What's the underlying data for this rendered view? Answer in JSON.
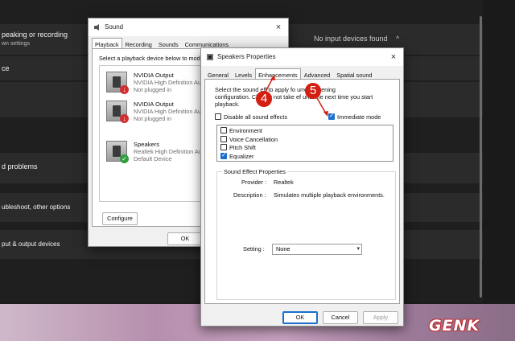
{
  "settings": {
    "row1_title": "peaking or recording",
    "row1_sub": "wn settings",
    "row1_status": "No input devices found",
    "row1_chevron": "^",
    "row2_title": "ce",
    "row3_title": "d problems",
    "row4_title": "ubleshoot, other options",
    "row5_title": "put & output devices"
  },
  "sound_dialog": {
    "title": "Sound",
    "close": "×",
    "tabs": [
      {
        "label": "Playback",
        "active": true
      },
      {
        "label": "Recording",
        "active": false
      },
      {
        "label": "Sounds",
        "active": false
      },
      {
        "label": "Communications",
        "active": false
      }
    ],
    "instruction": "Select a playback device below to modi",
    "devices": [
      {
        "name": "NVIDIA Output",
        "desc": "NVIDIA High Definition Au",
        "status": "Not plugged in",
        "badge": "down-arrow"
      },
      {
        "name": "NVIDIA Output",
        "desc": "NVIDIA High Definition Au",
        "status": "Not plugged in",
        "badge": "down-arrow"
      },
      {
        "name": "Speakers",
        "desc": "Realtek High Definition Au",
        "status": "Default Device",
        "badge": "check"
      }
    ],
    "configure_label": "Configure",
    "set_default_label": "S",
    "ok_label": "OK"
  },
  "props_dialog": {
    "title": "Speakers Properties",
    "close": "×",
    "tabs": [
      {
        "label": "General",
        "active": false
      },
      {
        "label": "Levels",
        "active": false
      },
      {
        "label": "Enhancements",
        "active": true
      },
      {
        "label": "Advanced",
        "active": false
      },
      {
        "label": "Spatial sound",
        "active": false
      }
    ],
    "desc_line1": "Select the sound eff        to apply fo        urrent listening",
    "desc_line2": "configuration. Ch        may not take ef       until the next time you start",
    "desc_line3": "playback.",
    "disable_all_label": "Disable all sound effects",
    "disable_all_checked": false,
    "immediate_mode_label": "Immediate mode",
    "immediate_mode_checked": true,
    "effects": [
      {
        "label": "Environment",
        "checked": false
      },
      {
        "label": "Voice Cancellation",
        "checked": false
      },
      {
        "label": "Pitch Shift",
        "checked": false
      },
      {
        "label": "Equalizer",
        "checked": true
      }
    ],
    "group_title": "Sound Effect Properties",
    "provider_label": "Provider :",
    "provider_value": "Realtek",
    "description_label": "Description :",
    "description_value": "Simulates multiple playback environments.",
    "setting_label": "Setting :",
    "setting_value": "None",
    "ok_label": "OK",
    "cancel_label": "Cancel",
    "apply_label": "Apply"
  },
  "annotations": {
    "step4": "4",
    "step5": "5",
    "accent_red": "#d41e12"
  },
  "watermark": "GENK"
}
